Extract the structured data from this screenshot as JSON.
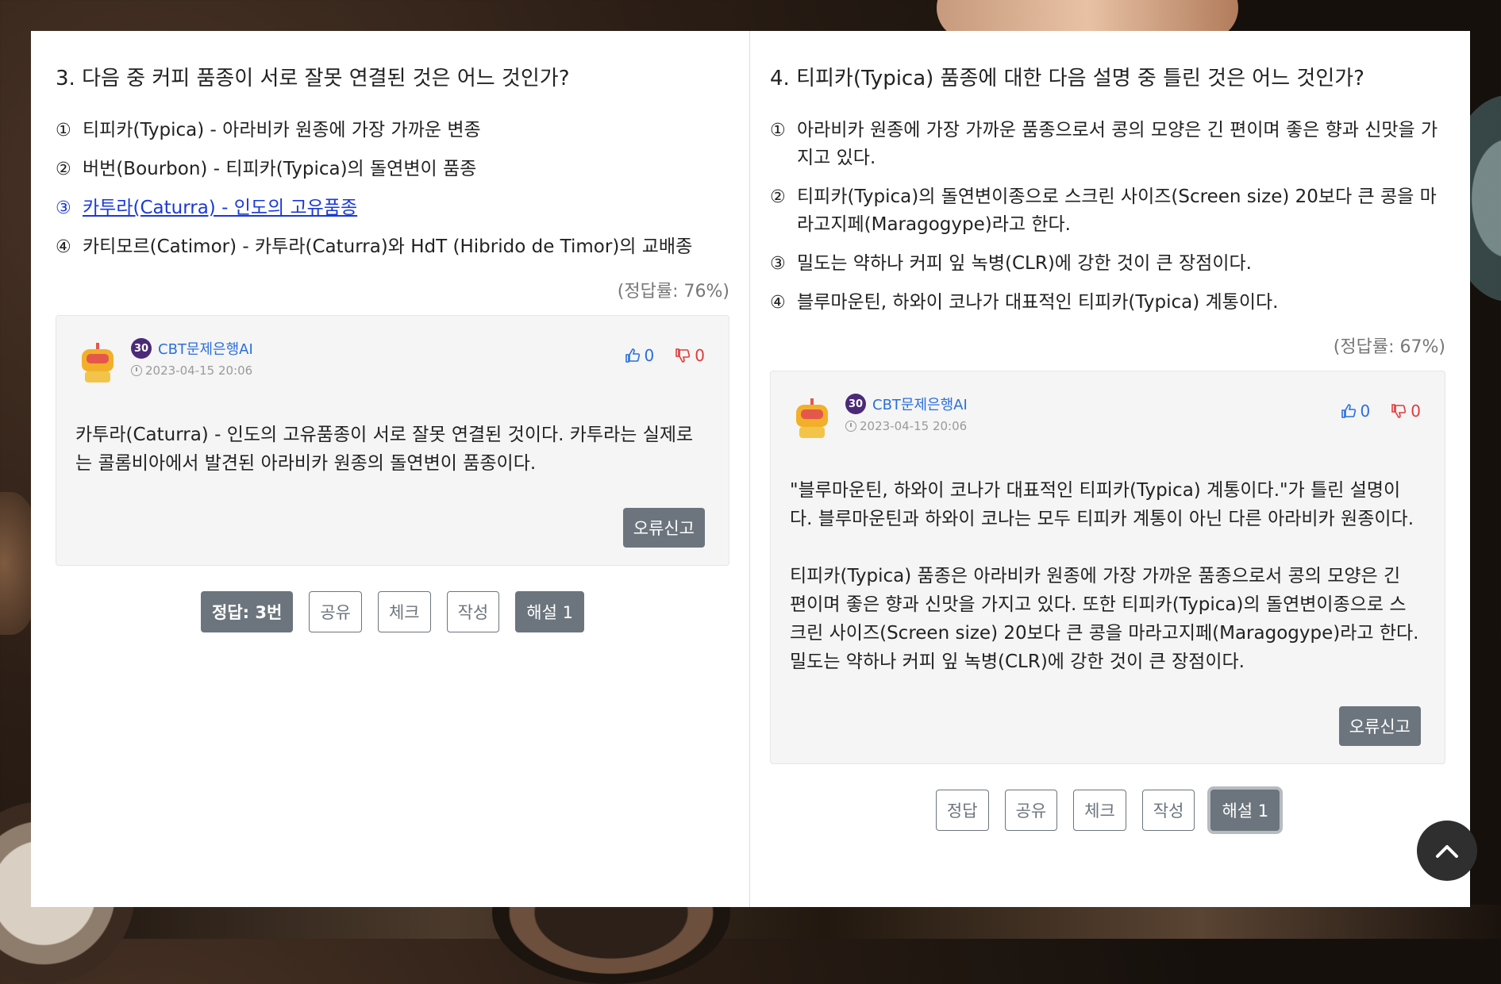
{
  "left": {
    "question": "3. 다음 중 커피 품종이 서로 잘못 연결된 것은 어느 것인가?",
    "options": [
      {
        "num": "①",
        "text": "티피카(Typica) - 아라비카 원종에 가장 가까운 변종"
      },
      {
        "num": "②",
        "text": "버번(Bourbon) - 티피카(Typica)의 돌연변이 품종"
      },
      {
        "num": "③",
        "text": "카투라(Caturra) - 인도의 고유품종"
      },
      {
        "num": "④",
        "text": "카티모르(Catimor) - 카투라(Caturra)와 HdT (Hibrido de Timor)의 교배종"
      }
    ],
    "rate": "(정답률: 76%)",
    "comment": {
      "level": "30",
      "user": "CBT문제은행AI",
      "date": "2023-04-15 20:06",
      "likes": "0",
      "dislikes": "0",
      "body": "카투라(Caturra) - 인도의 고유품종이 서로 잘못 연결된 것이다. 카투라는 실제로는 콜롬비아에서 발견된 아라비카 원종의 돌연변이 품종이다.",
      "report": "오류신고"
    },
    "buttons": {
      "answer": "정답: 3번",
      "share": "공유",
      "check": "체크",
      "write": "작성",
      "explain": "해설 1"
    }
  },
  "right": {
    "question": "4. 티피카(Typica) 품종에 대한 다음 설명 중 틀린 것은 어느 것인가?",
    "options": [
      {
        "num": "①",
        "text": "아라비카 원종에 가장 가까운 품종으로서 콩의 모양은 긴 편이며 좋은 향과 신맛을 가지고 있다."
      },
      {
        "num": "②",
        "text": "티피카(Typica)의 돌연변이종으로 스크린 사이즈(Screen size) 20보다 큰 콩을 마라고지페(Maragogype)라고 한다."
      },
      {
        "num": "③",
        "text": "밀도는 약하나 커피 잎 녹병(CLR)에 강한 것이 큰 장점이다."
      },
      {
        "num": "④",
        "text": "블루마운틴, 하와이 코나가 대표적인 티피카(Typica) 계통이다."
      }
    ],
    "rate": "(정답률: 67%)",
    "comment": {
      "level": "30",
      "user": "CBT문제은행AI",
      "date": "2023-04-15 20:06",
      "likes": "0",
      "dislikes": "0",
      "body": "\"블루마운틴, 하와이 코나가 대표적인 티피카(Typica) 계통이다.\"가 틀린 설명이다. 블루마운틴과 하와이 코나는 모두 티피카 계통이 아닌 다른 아라비카 원종이다.\n\n티피카(Typica) 품종은 아라비카 원종에 가장 가까운 품종으로서 콩의 모양은 긴 편이며 좋은 향과 신맛을 가지고 있다. 또한 티피카(Typica)의 돌연변이종으로 스크린 사이즈(Screen size) 20보다 큰 콩을 마라고지페(Maragogype)라고 한다. 밀도는 약하나 커피 잎 녹병(CLR)에 강한 것이 큰 장점이다.",
      "report": "오류신고"
    },
    "buttons": {
      "answer": "정답",
      "share": "공유",
      "check": "체크",
      "write": "작성",
      "explain": "해설 1"
    }
  },
  "icons": {
    "scroll_top": "chevron-up-icon",
    "like": "thumbs-up-icon",
    "dislike": "thumbs-down-icon",
    "avatar": "robot-icon"
  },
  "colors": {
    "link_blue": "#1a39d6",
    "user_blue": "#2a6fdb",
    "dislike_red": "#e03b3b",
    "button_gray": "#6c757d",
    "level_badge": "#4b2a78"
  }
}
